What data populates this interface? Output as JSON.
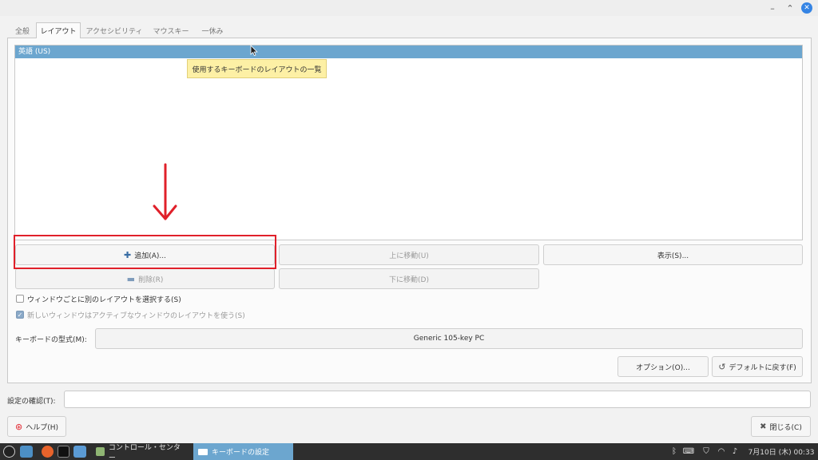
{
  "tabs": [
    {
      "label": "全般"
    },
    {
      "label": "レイアウト"
    },
    {
      "label": "アクセシビリティ"
    },
    {
      "label": "マウスキー"
    },
    {
      "label": "一休み"
    }
  ],
  "layout_list": {
    "rows": [
      "英語 (US)"
    ],
    "tooltip": "使用するキーボードのレイアウトの一覧"
  },
  "buttons": {
    "add": "追加(A)...",
    "move_up": "上に移動(U)",
    "show": "表示(S)...",
    "remove": "削除(R)",
    "move_down": "下に移動(D)",
    "options": "オプション(O)...",
    "reset": "デフォルトに戻す(F)",
    "help": "ヘルプ(H)",
    "close": "閉じる(C)"
  },
  "checks": {
    "per_window": "ウィンドウごとに別のレイアウトを選択する(S)",
    "new_window": "新しいウィンドウはアクティブなウィンドウのレイアウトを使う(S)"
  },
  "keyboard_model": {
    "label": "キーボードの型式(M):",
    "value": "Generic 105-key PC"
  },
  "test": {
    "label": "設定の確認(T):",
    "value": ""
  },
  "taskbar": {
    "control_center": "コントロール・センター",
    "keyboard_settings": "キーボードの設定",
    "clock": "7月10日 (木) 00:33"
  },
  "colors": {
    "selection": "#6ca6cf",
    "annotation": "#e0202a",
    "taskbar": "#2e2e2e",
    "tooltip": "#fdf0a5"
  }
}
